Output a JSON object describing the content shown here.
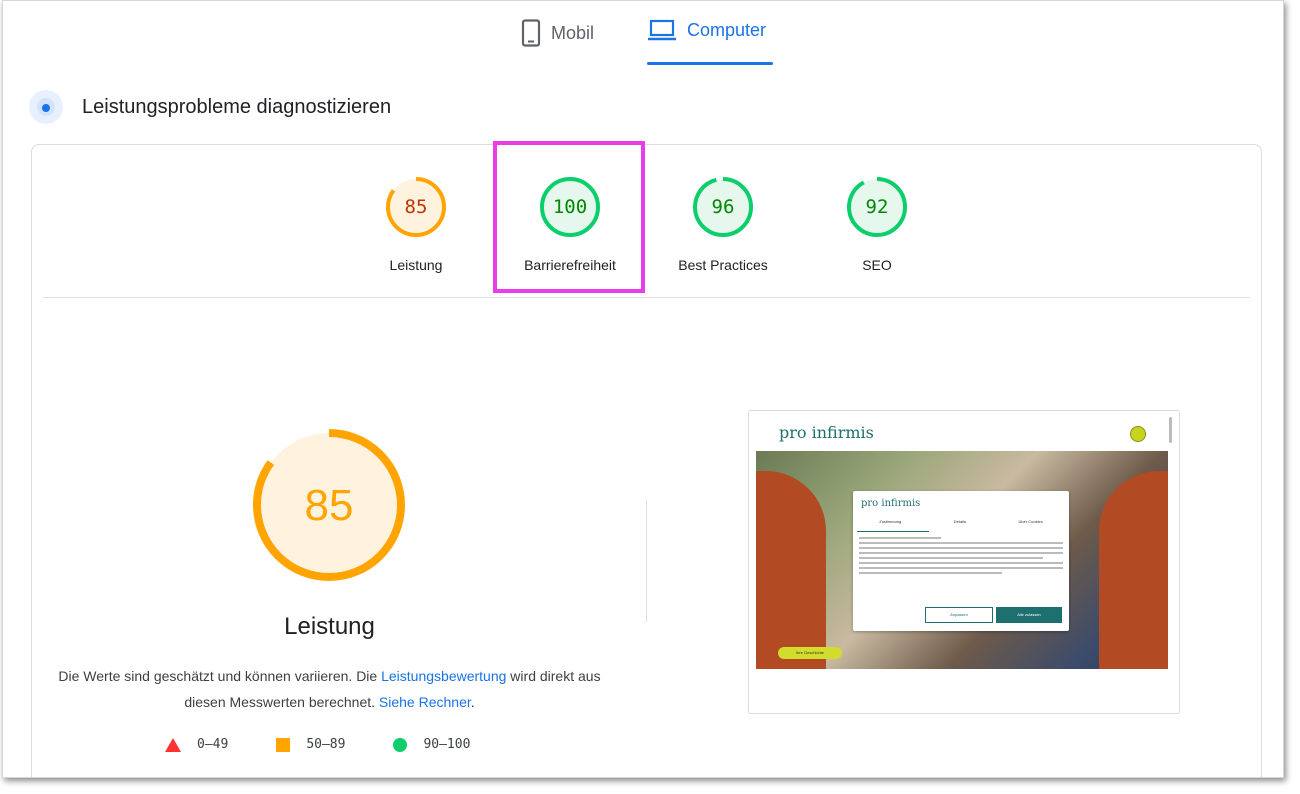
{
  "device_tabs": [
    {
      "label": "Mobil",
      "icon": "phone-icon",
      "active": false
    },
    {
      "label": "Computer",
      "icon": "laptop-icon",
      "active": true
    }
  ],
  "section": {
    "title": "Leistungsprobleme diagnostizieren",
    "icon": "lighthouse-icon"
  },
  "scores": [
    {
      "label": "Leistung",
      "value": "85",
      "color": "#ffa400",
      "bg": "#fff3e0",
      "text_color": "#c33300"
    },
    {
      "label": "Barrierefreiheit",
      "value": "100",
      "color": "#0cce6b",
      "bg": "#e6f7ed",
      "text_color": "#008800"
    },
    {
      "label": "Best Practices",
      "value": "96",
      "color": "#0cce6b",
      "bg": "#e6f7ed",
      "text_color": "#008800"
    },
    {
      "label": "SEO",
      "value": "92",
      "color": "#0cce6b",
      "bg": "#e6f7ed",
      "text_color": "#008800"
    }
  ],
  "detail": {
    "score": "85",
    "label": "Leistung",
    "desc_part1": "Die Werte sind geschätzt und können variieren. Die ",
    "link1": "Leistungsbewertung",
    "desc_part2": " wird direkt aus diesen Messwerten berechnet. ",
    "link2": "Siehe Rechner",
    "desc_part3": "."
  },
  "legend": [
    {
      "range": "0–49",
      "shape": "triangle",
      "color": "#ff3333"
    },
    {
      "range": "50–89",
      "shape": "square",
      "color": "#ffa400"
    },
    {
      "range": "90–100",
      "shape": "circle",
      "color": "#0cce6b"
    }
  ],
  "thumbnail": {
    "site_logo": "pro infirmis",
    "modal_logo": "pro infirmis",
    "modal_tabs": [
      "Zustimmung",
      "Details",
      "Über Cookies"
    ],
    "btn_allow_selection": "Anpassen",
    "btn_allow_all": "Alle zulassen",
    "pill": "Ihre Geschichte"
  }
}
